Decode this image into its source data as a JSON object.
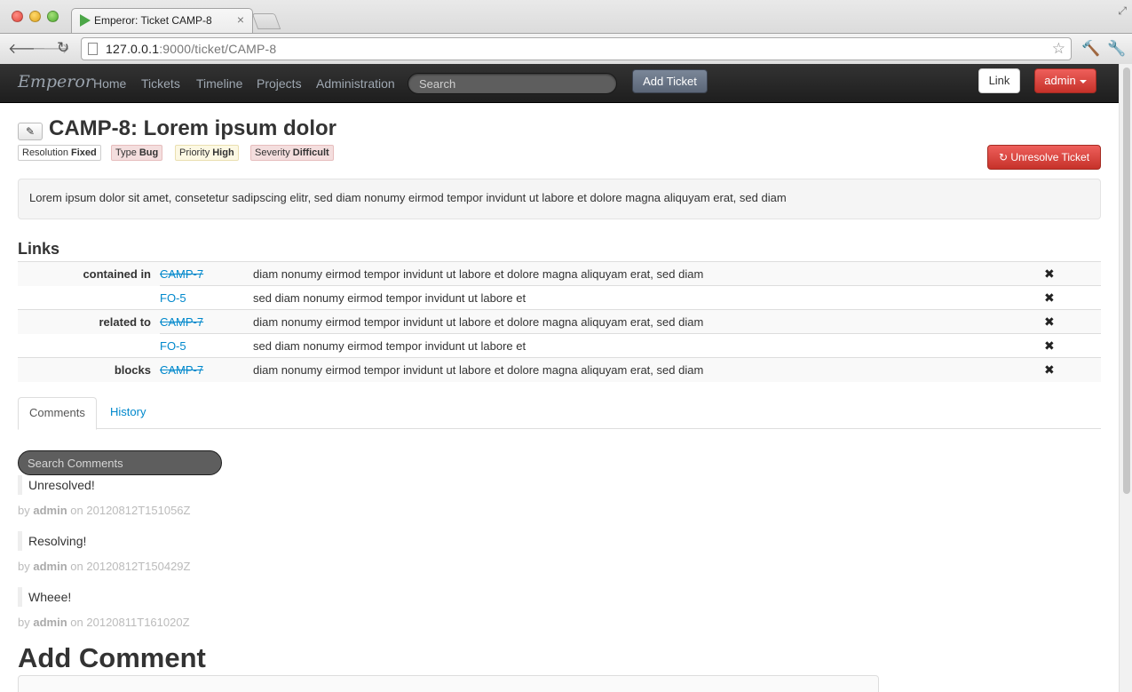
{
  "browser": {
    "tab_title": "Emperor: Ticket CAMP-8",
    "url_host": "127.0.0.1",
    "url_rest": ":9000/ticket/CAMP-8"
  },
  "navbar": {
    "brand": "Emperor",
    "links": [
      "Home",
      "Tickets",
      "Timeline",
      "Projects",
      "Administration"
    ],
    "search_placeholder": "Search",
    "add_ticket": "Add Ticket",
    "link_button": "Link",
    "user_menu": "admin"
  },
  "ticket": {
    "title": "CAMP-8: Lorem ipsum dolor",
    "tags": {
      "resolution_label": "Resolution",
      "resolution": "Fixed",
      "type_label": "Type",
      "type": "Bug",
      "priority_label": "Priority",
      "priority": "High",
      "severity_label": "Severity",
      "severity": "Difficult"
    },
    "unresolve_button": "Unresolve Ticket",
    "description": "Lorem ipsum dolor sit amet, consetetur sadipscing elitr, sed diam nonumy eirmod tempor invidunt ut labore et dolore magna aliquyam erat, sed diam"
  },
  "links": {
    "heading": "Links",
    "rows": [
      {
        "relation": "contained in",
        "key": "CAMP-7",
        "resolved": true,
        "summary": "diam nonumy eirmod tempor invidunt ut labore et dolore magna aliquyam erat, sed diam"
      },
      {
        "relation": "",
        "key": "FO-5",
        "resolved": false,
        "summary": "sed diam nonumy eirmod tempor invidunt ut labore et"
      },
      {
        "relation": "related to",
        "key": "CAMP-7",
        "resolved": true,
        "summary": "diam nonumy eirmod tempor invidunt ut labore et dolore magna aliquyam erat, sed diam"
      },
      {
        "relation": "",
        "key": "FO-5",
        "resolved": false,
        "summary": "sed diam nonumy eirmod tempor invidunt ut labore et"
      },
      {
        "relation": "blocks",
        "key": "CAMP-7",
        "resolved": true,
        "summary": "diam nonumy eirmod tempor invidunt ut labore et dolore magna aliquyam erat, sed diam"
      }
    ],
    "delete_glyph": "✖"
  },
  "tabs": {
    "comments": "Comments",
    "history": "History"
  },
  "comments": {
    "search_placeholder": "Search Comments",
    "items": [
      {
        "body": "Unresolved!",
        "by": "by",
        "author": "admin",
        "on": "on",
        "date": "20120812T151056Z"
      },
      {
        "body": "Resolving!",
        "by": "by",
        "author": "admin",
        "on": "on",
        "date": "20120812T150429Z"
      },
      {
        "body": "Wheee!",
        "by": "by",
        "author": "admin",
        "on": "on",
        "date": "20120811T161020Z"
      }
    ]
  },
  "add_comment": {
    "heading": "Add Comment"
  }
}
